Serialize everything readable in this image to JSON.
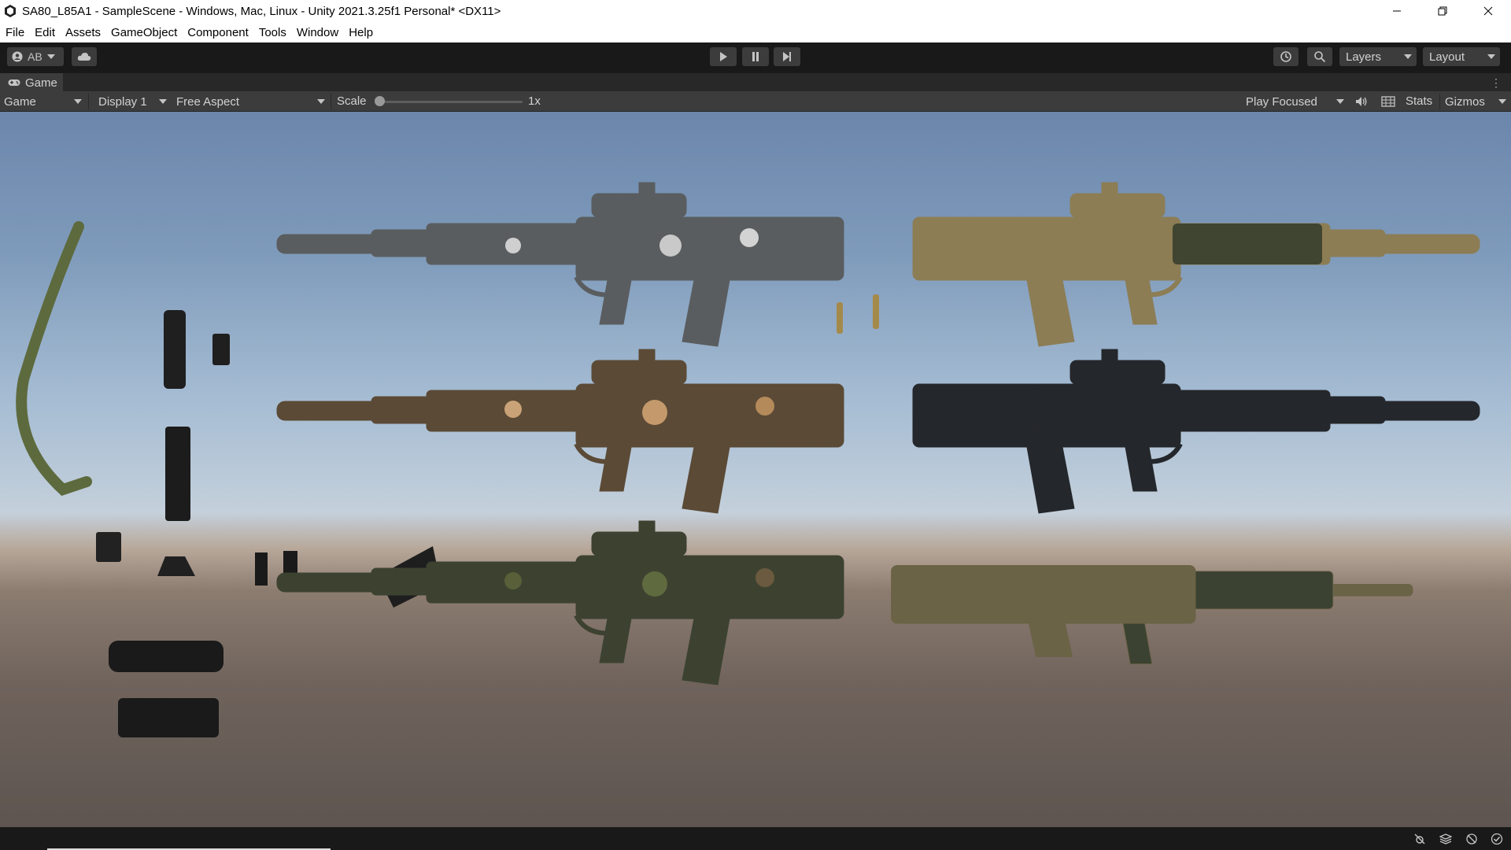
{
  "window": {
    "title": "SA80_L85A1 - SampleScene - Windows, Mac, Linux - Unity 2021.3.25f1 Personal* <DX11>"
  },
  "menu": [
    "File",
    "Edit",
    "Assets",
    "GameObject",
    "Component",
    "Tools",
    "Window",
    "Help"
  ],
  "toolbar": {
    "account_label": "AB",
    "layers_label": "Layers",
    "layout_label": "Layout"
  },
  "tab": {
    "label": "Game"
  },
  "game_toolbar": {
    "view_select": "Game",
    "display_select": "Display 1",
    "aspect_select": "Free Aspect",
    "scale_label": "Scale",
    "scale_value": "1x",
    "scale_fraction": 0.0,
    "play_mode": "Play Focused",
    "stats_label": "Stats",
    "gizmos_label": "Gizmos"
  },
  "colors": {
    "editor_dark": "#191919",
    "panel": "#3c3c3c",
    "text": "#d2d2d2",
    "sky_top": "#6b86ab",
    "ground": "#5e5550"
  },
  "scene_objects": [
    "sling",
    "flashlight",
    "suppressor",
    "sight-mount",
    "red-dot",
    "rail-covers",
    "magazine",
    "scope",
    "carry-handle",
    "rifle-arctic-camo",
    "rifle-desert-camo",
    "rifle-woodland-camo",
    "rifle-tan",
    "rifle-black",
    "rifle-olive-carbine",
    "cartridge-1",
    "cartridge-2"
  ]
}
